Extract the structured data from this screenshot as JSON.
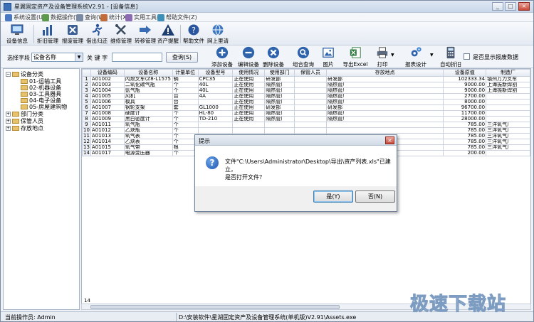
{
  "window": {
    "title": "星翼固定资产及设备管理系统V2.91 - [设备信息]",
    "min": "_",
    "max": "□",
    "close": "×"
  },
  "menu": [
    "系统设置(U)",
    "数据操作(V)",
    "查询(W)",
    "统计(X)",
    "实用工具(Y)",
    "帮助文件(Z)"
  ],
  "toolbar": [
    {
      "label": "设备信息",
      "icon": "monitor-icon"
    },
    {
      "label": "折旧管理",
      "icon": "bar-chart-icon"
    },
    {
      "label": "报废管理",
      "icon": "scrap-icon"
    },
    {
      "label": "借出归还",
      "icon": "person-run-icon"
    },
    {
      "label": "维修管理",
      "icon": "tools-icon"
    },
    {
      "label": "转移管理",
      "icon": "arrow-transfer-icon"
    },
    {
      "label": "资产提醒",
      "icon": "warning-icon"
    },
    {
      "label": "帮助文件",
      "icon": "help-icon"
    },
    {
      "label": "网上里请",
      "icon": "globe-icon"
    }
  ],
  "search": {
    "field_label": "选择字段",
    "field_value": "设备名称",
    "keyword_label": "关 键 字",
    "keyword_value": "",
    "query_button": "查询(S)"
  },
  "actions": [
    {
      "label": "添加设备",
      "icon": "plus-icon"
    },
    {
      "label": "编辑设备",
      "icon": "minus-icon"
    },
    {
      "label": "删除设备",
      "icon": "delete-icon"
    },
    {
      "label": "组合查询",
      "icon": "magnifier-icon"
    },
    {
      "label": "图片",
      "icon": "picture-icon"
    },
    {
      "label": "导出Excel",
      "icon": "excel-icon"
    },
    {
      "label": "打印",
      "icon": "printer-icon"
    },
    {
      "label": "报表设计",
      "icon": "gears-icon"
    },
    {
      "label": "自动折旧",
      "icon": "calculator-icon"
    }
  ],
  "show_scrap_label": "是否显示报废数据",
  "tree": {
    "root": "设备分类",
    "children": [
      "01-运输工具",
      "02-机器设备",
      "03-工具器具",
      "04-电子设备",
      "05-房屋建筑物"
    ],
    "others": [
      "部门分类",
      "保管人员",
      "存放地点"
    ]
  },
  "table": {
    "columns": [
      "",
      "设备编码",
      "设备名称",
      "计量单位",
      "设备型号",
      "使用情况",
      "使用部门",
      "保管人员",
      "存放地点",
      "设备原值",
      "制造厂"
    ],
    "rows": [
      [
        "1",
        "A01002",
        "内燃叉车(Z8-L1575",
        "辆",
        "CPC35",
        "正在使用",
        "研发部",
        "",
        "研发部",
        "102333.34",
        "镇州万力叉车"
      ],
      [
        "2",
        "A01003",
        "二氧化碳气瓶",
        "个",
        "40L",
        "正在使用",
        "隔热管厂",
        "",
        "隔热管厂",
        "9000.00",
        "上海振新焊割"
      ],
      [
        "3",
        "A01004",
        "氩气瓶",
        "个",
        "40L",
        "正在使用",
        "隔热管厂",
        "",
        "隔热管厂",
        "9000.00",
        "上海振新焊割"
      ],
      [
        "4",
        "A01005",
        "风机",
        "台",
        "4A",
        "正在使用",
        "隔热管厂",
        "",
        "隔热管厂",
        "2700.00",
        ""
      ],
      [
        "5",
        "A01006",
        "模具",
        "台",
        "",
        "正在使用",
        "隔热管厂",
        "",
        "隔热管厂",
        "8000.00",
        ""
      ],
      [
        "6",
        "A01007",
        "钢轮支架",
        "套",
        "GL1000",
        "正在使用",
        "研发部",
        "",
        "研发部",
        "96700.00",
        ""
      ],
      [
        "7",
        "A01008",
        "硬度计",
        "个",
        "HL-80",
        "正在使用",
        "隔热管厂",
        "",
        "隔热管厂",
        "11700.00",
        ""
      ],
      [
        "8",
        "A01009",
        "黑白密度计",
        "个",
        "TD-210",
        "正在使用",
        "隔热管厂",
        "",
        "隔热管厂",
        "28000.00",
        ""
      ],
      [
        "9",
        "A01011",
        "氧气瓶",
        "个",
        "",
        "",
        "",
        "",
        "",
        "785.00",
        "三洋氧气厂"
      ],
      [
        "10",
        "A01012",
        "乙炔瓶",
        "个",
        "",
        "",
        "",
        "",
        "",
        "785.00",
        "三洋氧气厂"
      ],
      [
        "11",
        "A01013",
        "氧气表",
        "个",
        "",
        "",
        "",
        "",
        "",
        "785.00",
        "三洋氧气厂"
      ],
      [
        "12",
        "A01014",
        "乙炔表",
        "个",
        "",
        "",
        "",
        "",
        "",
        "785.00",
        "三洋氧气厂"
      ],
      [
        "13",
        "A01015",
        "氧气带",
        "根",
        "",
        "",
        "",
        "",
        "",
        "785.00",
        "三洋氧气厂"
      ],
      [
        "14",
        "A01017",
        "电源变压器",
        "个",
        "",
        "",
        "",
        "",
        "",
        "200.00",
        ""
      ]
    ],
    "footer_count": "14"
  },
  "status": {
    "operator": "当前操作员: Admin",
    "path": "D:\\安装软件\\星湖固定资产及设备管理系统(单机版)V2.91\\Assets.exe"
  },
  "dialog": {
    "title": "提示",
    "line1": "文件\"C:\\Users\\Administrator\\Desktop\\导出\\资产列表.xls\"已建立，",
    "line2": "是否打开文件？",
    "yes": "是(Y)",
    "no": "否(N)"
  },
  "watermark": "极速下载站",
  "colors": {
    "accent": "#3b6fb6",
    "title_bg": "#c9d7e9",
    "grid_border": "#c9d2de"
  }
}
